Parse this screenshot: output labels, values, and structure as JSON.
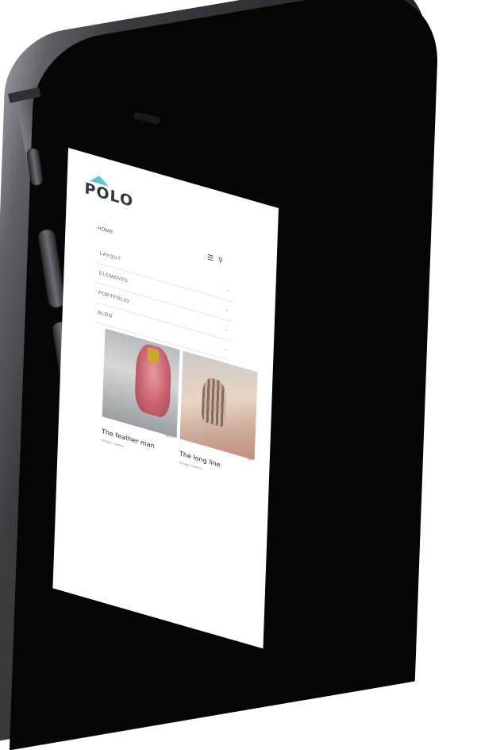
{
  "site": {
    "logo": "POLO"
  },
  "nav": {
    "home": "HOME",
    "items": [
      {
        "label": "LAYOUT"
      },
      {
        "label": "ELEMENTS"
      },
      {
        "label": "PORTFOLIO"
      },
      {
        "label": "BLOG"
      }
    ]
  },
  "icons": {
    "menu": "menu-icon",
    "search": "search-icon",
    "chevron": "chevron-down-icon"
  },
  "cards": [
    {
      "title": "The feather man",
      "meta": "Design, Fashion",
      "date": "April 2"
    },
    {
      "title": "The long line",
      "meta": "Design, Fashion",
      "date": "05"
    }
  ]
}
